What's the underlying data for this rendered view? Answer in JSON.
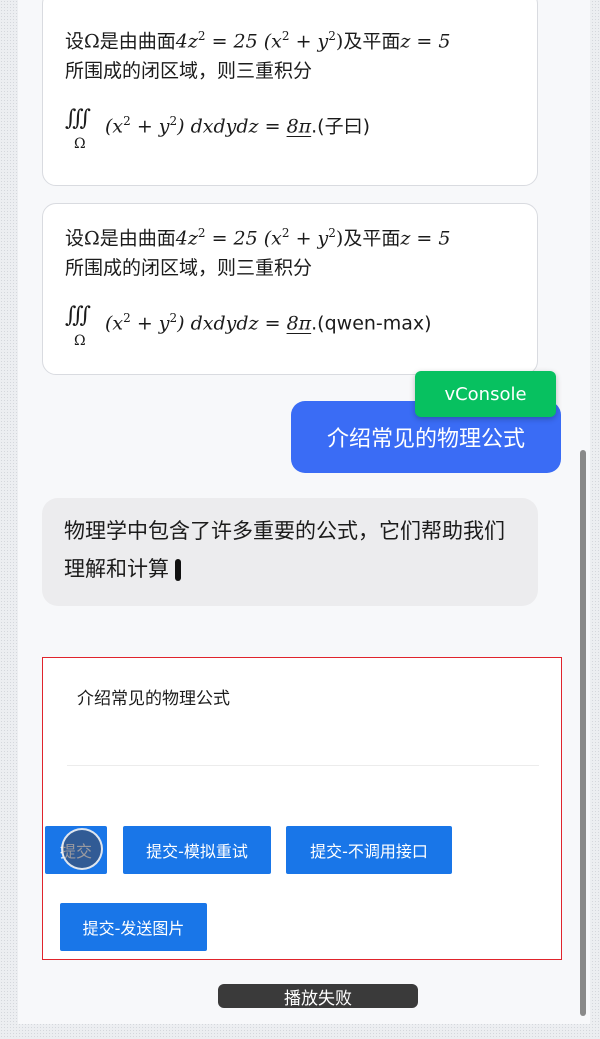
{
  "messages": [
    {
      "line1_prefix": "设",
      "omega": "Ω",
      "line1_mid": "是由曲面",
      "surface_lhs": "4z",
      "surface_rhs": "= 25 (x",
      "surface_mid": " + y",
      "surface_end": ")",
      "line1_suffix": "及平面",
      "plane": "z = 5",
      "line2": "所围成的闭区域，则三重积分",
      "integral_symbol": "∭",
      "integral_sub": "Ω",
      "integrand_open": "(x",
      "integrand_mid": " + y",
      "integrand_close": ") dxdydz =",
      "answer": "8π",
      "source": ".(子曰)"
    },
    {
      "line1_prefix": "设",
      "omega": "Ω",
      "line1_mid": "是由曲面",
      "surface_lhs": "4z",
      "surface_rhs": "= 25 (x",
      "surface_mid": " + y",
      "surface_end": ")",
      "line1_suffix": "及平面",
      "plane": "z = 5",
      "line2": "所围成的闭区域，则三重积分",
      "integral_symbol": "∭",
      "integral_sub": "Ω",
      "integrand_open": "(x",
      "integrand_mid": " + y",
      "integrand_close": ") dxdydz =",
      "answer": "8π",
      "source": ".(qwen-max)"
    }
  ],
  "exponent": "2",
  "vconsole_label": "vConsole",
  "user_message": "介绍常见的物理公式",
  "assistant_streaming": "物理学中包含了许多重要的公式，它们帮助我们理解和计算",
  "input": {
    "value": "介绍常见的物理公式"
  },
  "buttons": {
    "submit": "提交",
    "retry": "提交-模拟重试",
    "no_api": "提交-不调用接口",
    "send_image": "提交-发送图片"
  },
  "toast": "播放失败",
  "colors": {
    "user_bubble": "#3a6cf5",
    "vconsole": "#07c160",
    "button": "#1976e8",
    "panel_border": "#e0242c"
  }
}
